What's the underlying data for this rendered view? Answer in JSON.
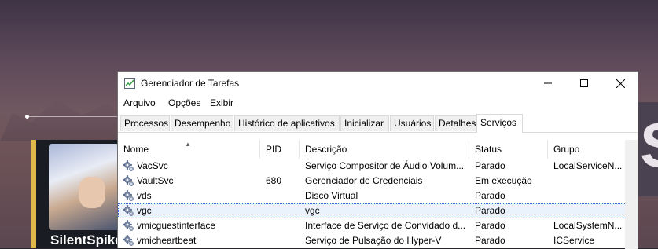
{
  "desktop": {
    "player_name": "SilentSpike",
    "right_glyph": "S"
  },
  "window": {
    "title": "Gerenciador de Tarefas",
    "controls": {
      "minimize": "minimize",
      "maximize": "maximize",
      "close": "close"
    }
  },
  "menu": [
    "Arquivo",
    "Opções",
    "Exibir"
  ],
  "tabs": [
    "Processos",
    "Desempenho",
    "Histórico de aplicativos",
    "Inicializar",
    "Usuários",
    "Detalhes",
    "Serviços"
  ],
  "active_tab": "Serviços",
  "table": {
    "columns": [
      "Nome",
      "PID",
      "Descrição",
      "Status",
      "Grupo"
    ],
    "sorted_column": "Nome",
    "rows": [
      {
        "name": "VacSvc",
        "pid": "",
        "description": "Serviço Compositor de Áudio Volum...",
        "status": "Parado",
        "group": "LocalServiceN..."
      },
      {
        "name": "VaultSvc",
        "pid": "680",
        "description": "Gerenciador de Credenciais",
        "status": "Em execução",
        "group": ""
      },
      {
        "name": "vds",
        "pid": "",
        "description": "Disco Virtual",
        "status": "Parado",
        "group": ""
      },
      {
        "name": "vgc",
        "pid": "",
        "description": "vgc",
        "status": "Parado",
        "group": "",
        "selected": true
      },
      {
        "name": "vmicguestinterface",
        "pid": "",
        "description": "Interface de Serviço de Convidado d...",
        "status": "Parado",
        "group": "LocalSystemN..."
      },
      {
        "name": "vmicheartbeat",
        "pid": "",
        "description": "Serviço de Pulsação do Hyper-V",
        "status": "Parado",
        "group": "ICService"
      }
    ]
  },
  "colors": {
    "selection_bg": "#eaf3fc",
    "selection_border": "#2b69c9",
    "card_accent": "#e0b94a"
  }
}
